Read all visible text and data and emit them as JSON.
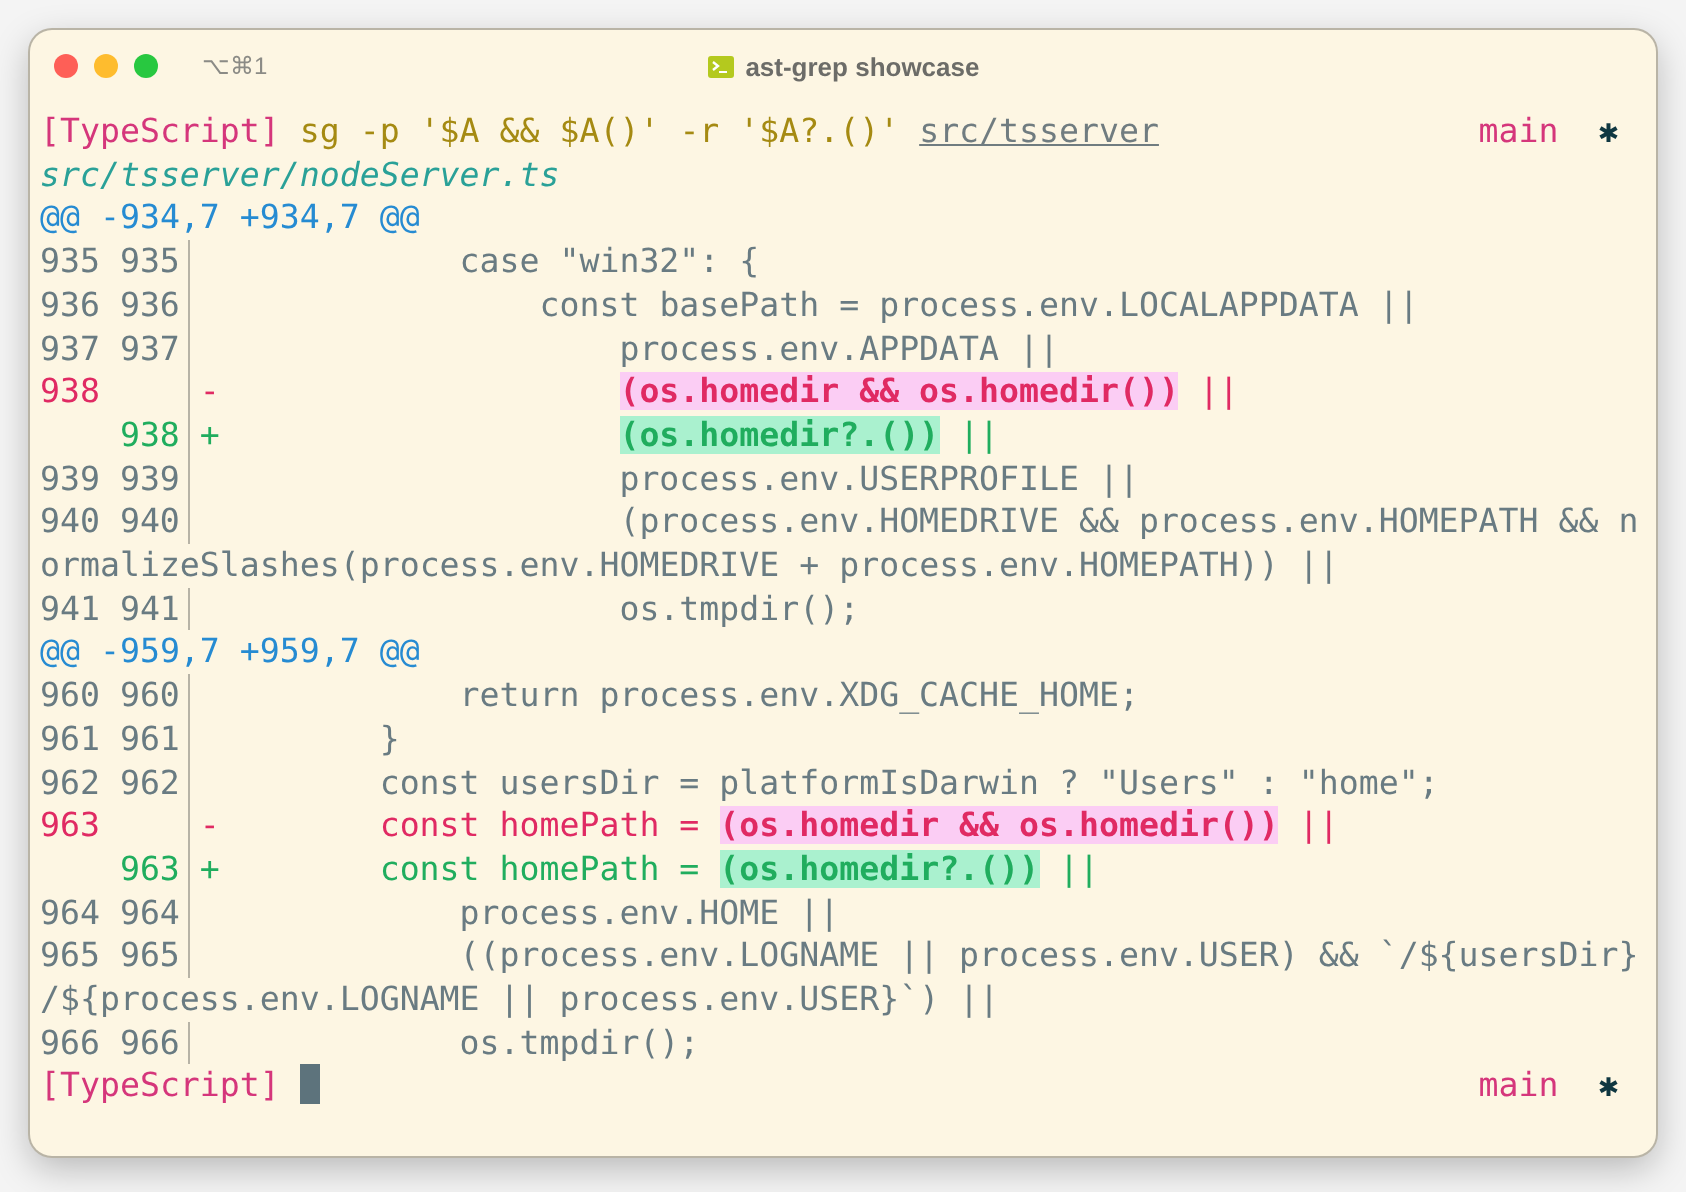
{
  "window": {
    "shortcut": "⌥⌘1",
    "title": "ast-grep showcase"
  },
  "prompt": {
    "language": "[TypeScript]",
    "command": "sg -p '$A && $A()' -r '$A?.()'",
    "path": "src/tsserver",
    "branch": "main",
    "status": "✱"
  },
  "file": "src/tsserver/nodeServer.ts",
  "hunks": [
    {
      "header": "@@ -934,7 +934,7 @@",
      "lines": [
        {
          "kind": "context",
          "old": "935",
          "new": "935",
          "code": "            case \"win32\": {"
        },
        {
          "kind": "context",
          "old": "936",
          "new": "936",
          "code": "                const basePath = process.env.LOCALAPPDATA ||"
        },
        {
          "kind": "context",
          "old": "937",
          "new": "937",
          "code": "                    process.env.APPDATA ||"
        },
        {
          "kind": "removed",
          "old": "938",
          "sign": "-",
          "segments": [
            {
              "text": "                    (os.homedir && os.homedir())",
              "highlight": true
            },
            {
              "text": " ||",
              "highlight": false
            }
          ]
        },
        {
          "kind": "added",
          "new": "938",
          "sign": "+",
          "segments": [
            {
              "text": "                    (os.homedir?.())",
              "highlight": true
            },
            {
              "text": " ||",
              "highlight": false
            }
          ]
        },
        {
          "kind": "context",
          "old": "939",
          "new": "939",
          "code": "                    process.env.USERPROFILE ||"
        },
        {
          "kind": "context",
          "old": "940",
          "new": "940",
          "code": "                    (process.env.HOMEDRIVE && process.env.HOMEPATH && n",
          "wrap": "ormalizeSlashes(process.env.HOMEDRIVE + process.env.HOMEPATH)) ||"
        },
        {
          "kind": "context",
          "old": "941",
          "new": "941",
          "code": "                    os.tmpdir();"
        }
      ]
    },
    {
      "header": "@@ -959,7 +959,7 @@",
      "lines": [
        {
          "kind": "context",
          "old": "960",
          "new": "960",
          "code": "            return process.env.XDG_CACHE_HOME;"
        },
        {
          "kind": "context",
          "old": "961",
          "new": "961",
          "code": "        }"
        },
        {
          "kind": "context",
          "old": "962",
          "new": "962",
          "code": "        const usersDir = platformIsDarwin ? \"Users\" : \"home\";"
        },
        {
          "kind": "removed",
          "old": "963",
          "sign": "-",
          "segments": [
            {
              "text": "        const homePath = ",
              "highlight": false
            },
            {
              "text": "(os.homedir && os.homedir())",
              "highlight": true
            },
            {
              "text": " ||",
              "highlight": false
            }
          ]
        },
        {
          "kind": "added",
          "new": "963",
          "sign": "+",
          "segments": [
            {
              "text": "        const homePath = ",
              "highlight": false
            },
            {
              "text": "(os.homedir?.())",
              "highlight": true
            },
            {
              "text": " ||",
              "highlight": false
            }
          ]
        },
        {
          "kind": "context",
          "old": "964",
          "new": "964",
          "code": "            process.env.HOME ||"
        },
        {
          "kind": "context",
          "old": "965",
          "new": "965",
          "code": "            ((process.env.LOGNAME || process.env.USER) && `/${usersDir}",
          "wrap": "/${process.env.LOGNAME || process.env.USER}`) ||"
        },
        {
          "kind": "context",
          "old": "966",
          "new": "966",
          "code": "            os.tmpdir();"
        }
      ]
    }
  ],
  "bottom_prompt": {
    "language": "[TypeScript]",
    "branch": "main",
    "status": "✱"
  }
}
